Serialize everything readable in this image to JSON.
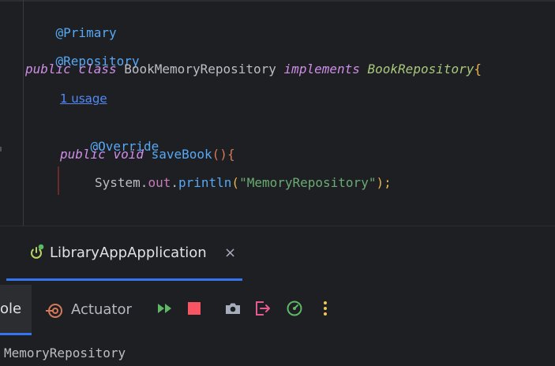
{
  "editor": {
    "lines": {
      "l1": "@Primary",
      "l2": "@Repository",
      "l3": {
        "kw1": "public",
        "kw2": "class",
        "cls": "BookMemoryRepository",
        "kw3": "implements",
        "iface": "BookRepository",
        "brace": "{"
      },
      "usage": "1 usage",
      "l4": "@Override",
      "l5": {
        "kw1": "public",
        "kw2": "void",
        "meth": "saveBook",
        "paren": "()",
        "brace": "{"
      },
      "l6": {
        "sys": "System.",
        "out": "out",
        "dot": ".",
        "println": "println",
        "lp": "(",
        "str": "\"MemoryRepository\"",
        "rp": ");"
      },
      "l7": "}"
    }
  },
  "run_panel": {
    "tab_label": "LibraryAppApplication",
    "tab_close": "×",
    "console_tab_partial": "ole",
    "actuator_label": "Actuator",
    "output_line": "MemoryRepository"
  },
  "colors": {
    "accent": "#3574f0",
    "rerun_green": "#5fb865",
    "stop_red": "#f75464",
    "exit_pink": "#e55a8f",
    "more_yellow": "#f2c55c"
  }
}
